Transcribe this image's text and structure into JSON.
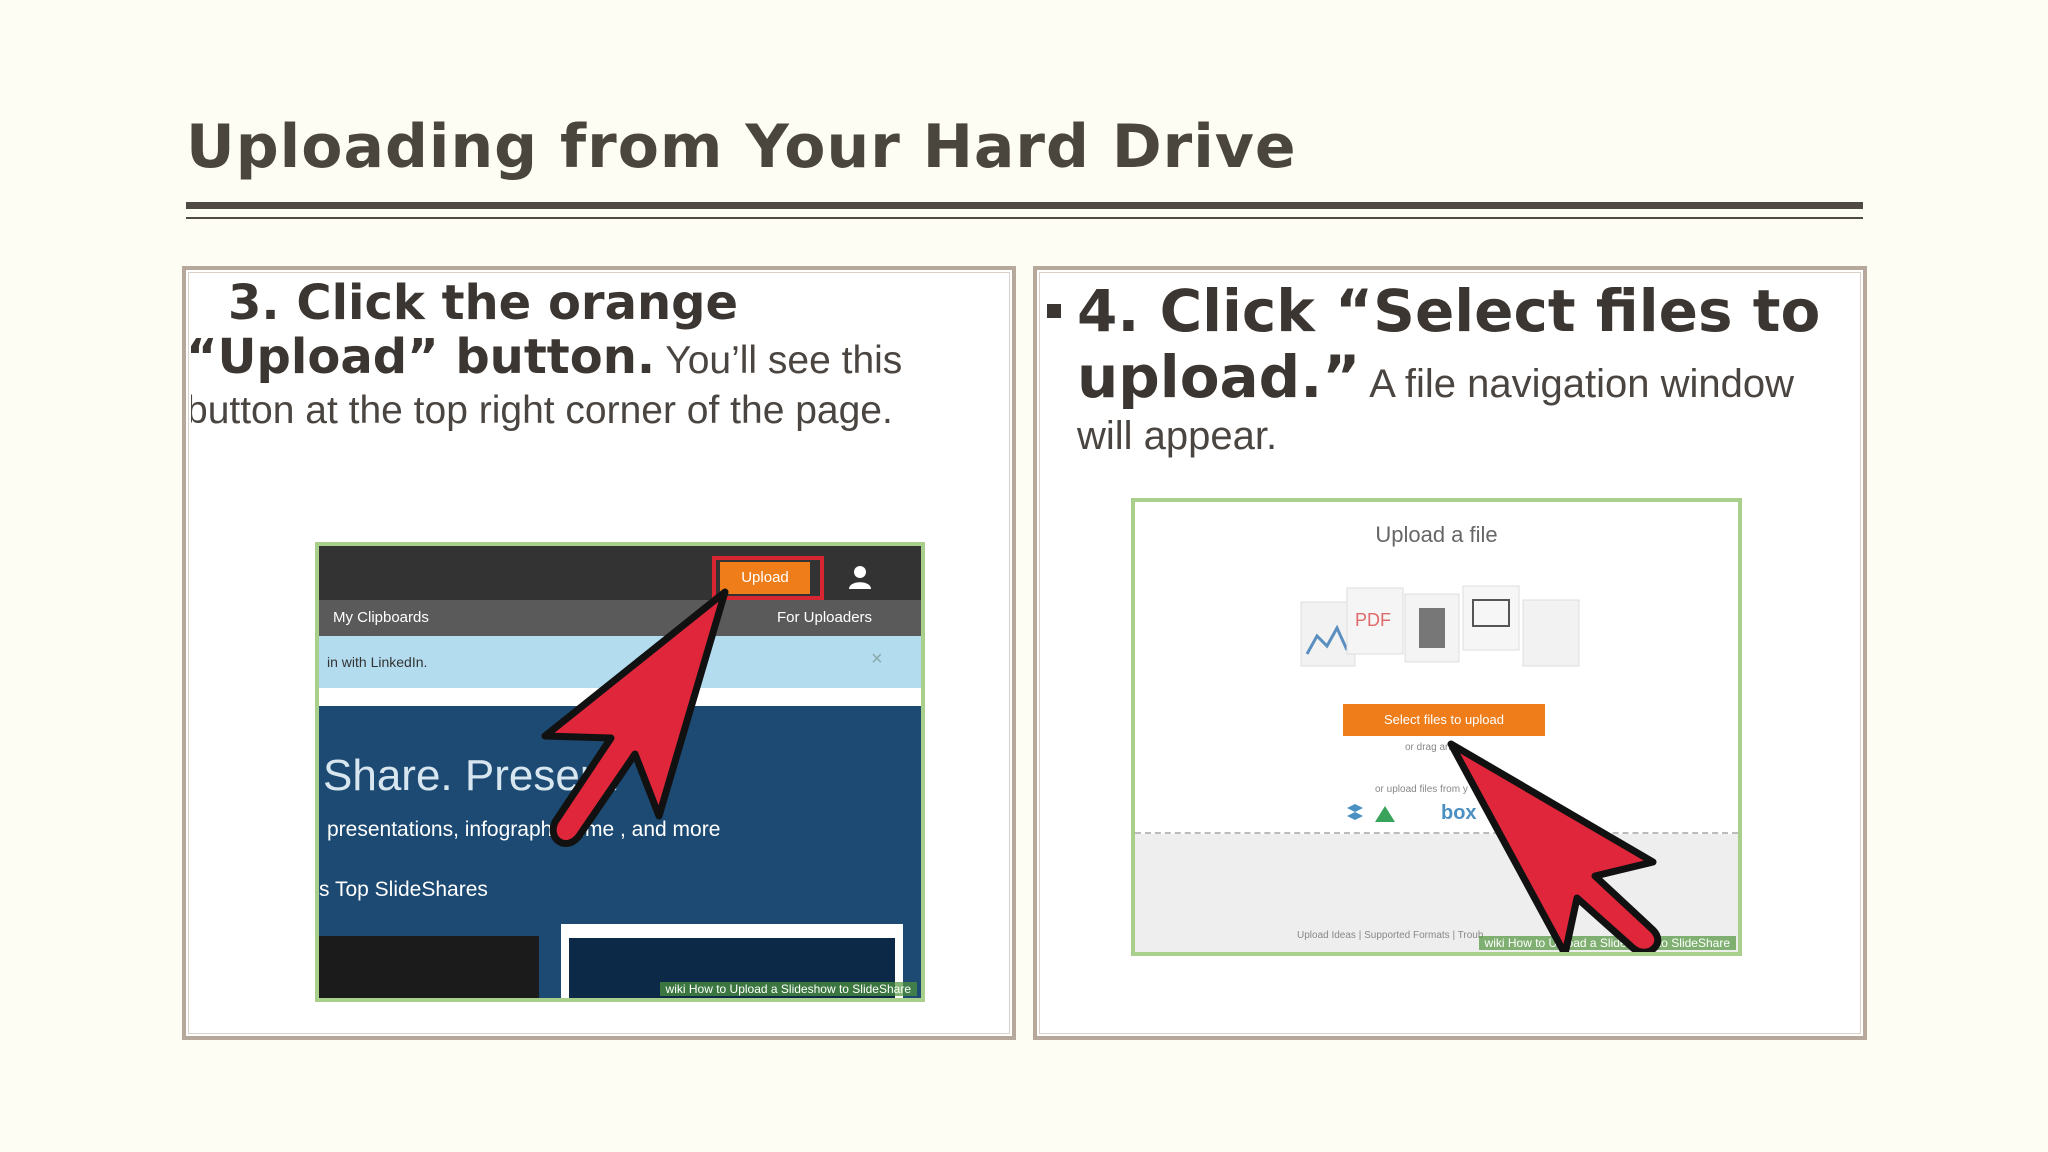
{
  "slide": {
    "title": "Uploading from Your Hard Drive"
  },
  "left_panel": {
    "step_heading": "3. Click the orange “Upload” button.",
    "step_body": " You’ll see this button at the top right corner of the page.",
    "screenshot": {
      "upload_button": "Upload",
      "nav_left": "My Clipboards",
      "nav_right": "For Uploaders",
      "banner": "in with LinkedIn.",
      "banner_close": "×",
      "hero_title": "Share. Present",
      "hero_subtitle": "presentations, infographi     cume    , and more",
      "top_label": "s Top SlideShares",
      "watermark": "wiki How to Upload a Slideshow to SlideShare"
    }
  },
  "right_panel": {
    "step_heading": "4. Click “Select files to upload.”",
    "step_body": " A file navigation window will appear.",
    "screenshot": {
      "title": "Upload a file",
      "pdf_label": "PDF",
      "select_button": "Select files to upload",
      "drag_text": "or drag an",
      "or_upload_text": "or upload files from y",
      "box_label": "box",
      "footer_text": "Upload Ideas  |  Supported Formats  |  Troub",
      "watermark": "wiki How to Upload a Slideshow to SlideShare"
    }
  },
  "colors": {
    "background": "#fdfdf3",
    "rule": "#4f4a43",
    "panel_border": "#b6a89a",
    "screenshot_border": "#a9cf8c",
    "upload_orange": "#ef7d1a",
    "pointer_red": "#e0263a"
  }
}
